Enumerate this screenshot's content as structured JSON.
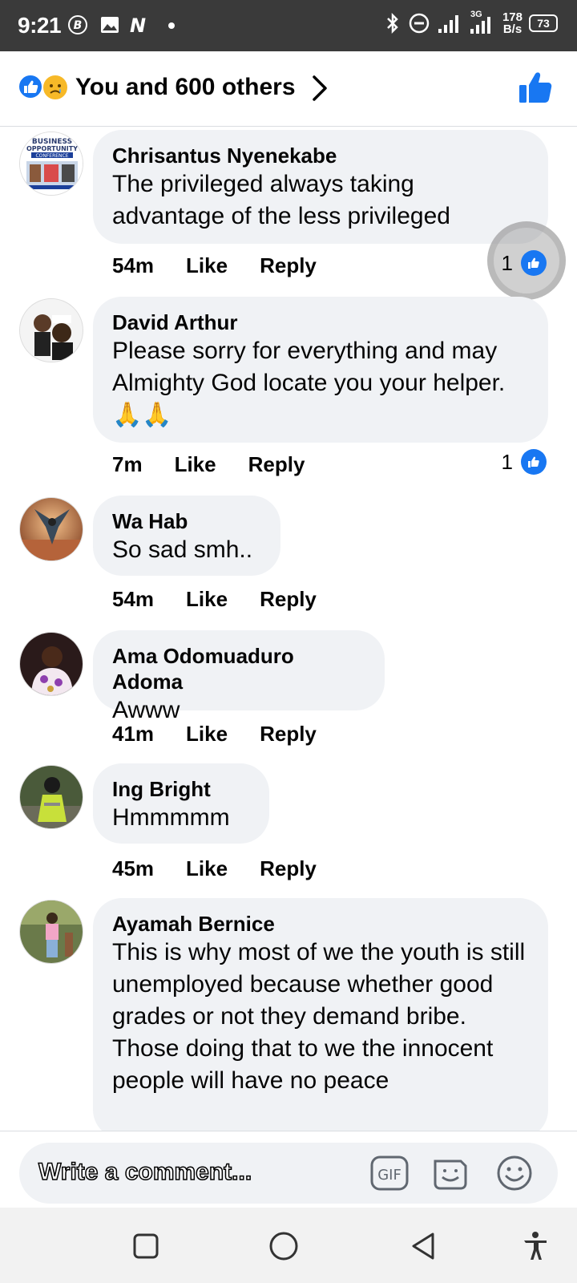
{
  "status_bar": {
    "time": "9:21",
    "net_speed_top": "178",
    "net_speed_bottom": "B/s",
    "battery": "73",
    "network": "3G"
  },
  "header": {
    "reactions_text": "You and 600 others",
    "reaction_icons": [
      "like-icon",
      "sad-icon"
    ]
  },
  "comments": [
    {
      "author": "Chrisantus Nyenekabe",
      "text": "The privileged always taking advantage of the less privileged",
      "time": "54m",
      "like": "Like",
      "reply": "Reply",
      "reactions": "1"
    },
    {
      "author": "David Arthur",
      "text": "Please sorry for everything and may Almighty God locate you your helper. 🙏🙏",
      "time": "7m",
      "like": "Like",
      "reply": "Reply",
      "reactions": "1"
    },
    {
      "author": "Wa Hab",
      "text": "So sad smh..",
      "time": "54m",
      "like": "Like",
      "reply": "Reply"
    },
    {
      "author": "Ama Odomuaduro Adoma",
      "text": "Awww",
      "time": "41m",
      "like": "Like",
      "reply": "Reply"
    },
    {
      "author": "Ing Bright",
      "text": "Hmmmmm",
      "time": "45m",
      "like": "Like",
      "reply": "Reply"
    },
    {
      "author": "Ayamah Bernice",
      "text": "This is why most of we the youth is still unemployed because whether good grades or not they demand bribe. Those doing that to we the innocent people will have no peace"
    }
  ],
  "avatar_logo_text": {
    "line1": "BUSINESS",
    "line2": "OPPORTUNITY",
    "line3": "CONFERENCE"
  },
  "composer": {
    "placeholder": "Write a comment...",
    "gif_label": "GIF"
  },
  "colors": {
    "accent": "#1877f2",
    "bubble": "#f0f2f5",
    "status_bar": "#3a3a3a"
  }
}
